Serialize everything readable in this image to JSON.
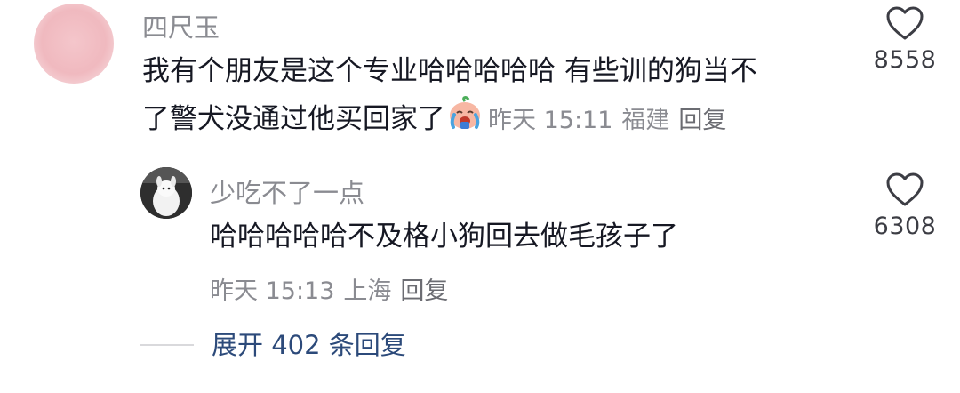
{
  "comments": [
    {
      "username": "四尺玉",
      "text_line1": "我有个朋友是这个专业哈哈哈哈哈 有些训的狗当不",
      "text_line2": "了警犬没通过他买回家了",
      "emoji": "crying-laughing-emoji",
      "time": "昨天 15:11",
      "location": "福建",
      "reply_label": "回复",
      "likes": "8558"
    },
    {
      "username": "少吃不了一点",
      "text_line1": "哈哈哈哈哈不及格小狗回去做毛孩子了",
      "time": "昨天 15:13",
      "location": "上海",
      "reply_label": "回复",
      "likes": "6308"
    }
  ],
  "expand_replies": "展开 402 条回复",
  "colors": {
    "text": "#161823",
    "muted": "#8a8b91",
    "link": "#2c4a7a"
  }
}
